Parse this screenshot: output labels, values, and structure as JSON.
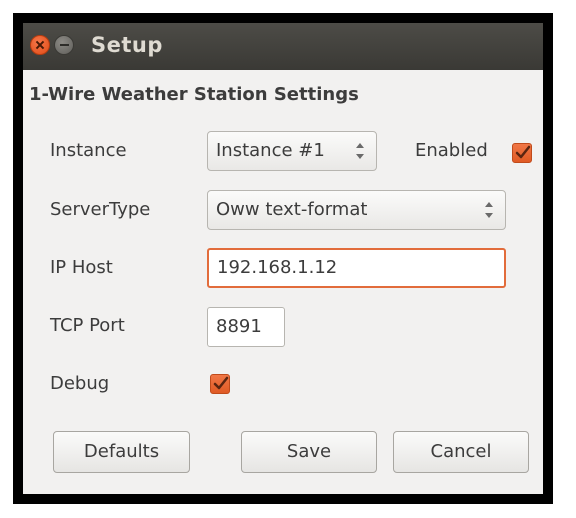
{
  "window": {
    "title": "Setup",
    "close_icon": "close-icon",
    "minimize_icon": "minimize-icon"
  },
  "section_title": "1-Wire Weather Station Settings",
  "fields": {
    "instance": {
      "label": "Instance",
      "value": "Instance #1"
    },
    "enabled": {
      "label": "Enabled",
      "checked": true
    },
    "server_type": {
      "label": "ServerType",
      "value": "Oww text-format"
    },
    "ip_host": {
      "label": "IP Host",
      "value": "192.168.1.12"
    },
    "tcp_port": {
      "label": "TCP Port",
      "value": "8891"
    },
    "debug": {
      "label": "Debug",
      "checked": true
    }
  },
  "buttons": {
    "defaults": "Defaults",
    "save": "Save",
    "cancel": "Cancel"
  },
  "colors": {
    "accent": "#e26c3b",
    "titlebar": "#3c3b37",
    "window_bg": "#f2f1f0"
  }
}
